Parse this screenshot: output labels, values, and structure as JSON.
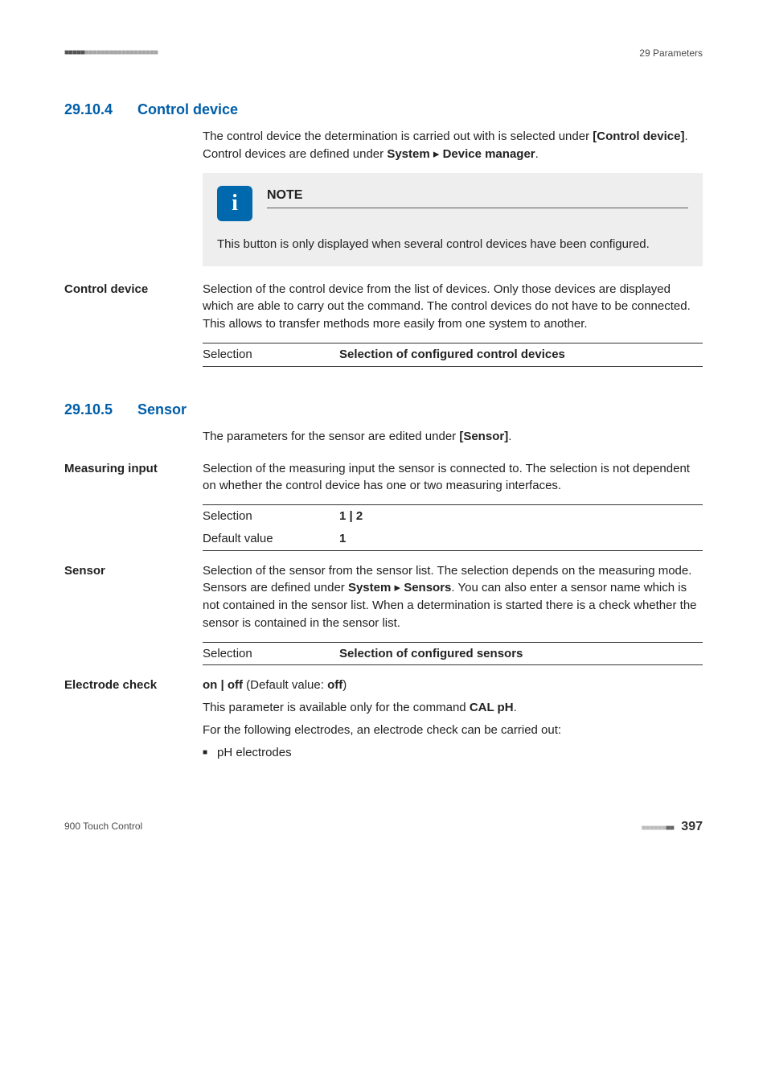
{
  "header": {
    "right": "29 Parameters"
  },
  "sections": {
    "s1": {
      "num": "29.10.4",
      "title": "Control device",
      "intro_before_bold": "The control device the determination is carried out with is selected under ",
      "intro_bold": "[Control device]",
      "intro_mid": ". Control devices are defined under ",
      "intro_path1": "System",
      "intro_path2": "Device manager",
      "intro_after": "."
    },
    "note": {
      "title": "NOTE",
      "body": "This button is only displayed when several control devices have been configured."
    },
    "control_device": {
      "label": "Control device",
      "text": "Selection of the control device from the list of devices. Only those devices are displayed which are able to carry out the command. The control devices do not have to be connected. This allows to transfer methods more easily from one system to another.",
      "sel_label": "Selection",
      "sel_value": "Selection of configured control devices"
    },
    "s2": {
      "num": "29.10.5",
      "title": "Sensor",
      "intro_before_bold": "The parameters for the sensor are edited under ",
      "intro_bold": "[Sensor]",
      "intro_after": "."
    },
    "measuring_input": {
      "label": "Measuring input",
      "text": "Selection of the measuring input the sensor is connected to. The selection is not dependent on whether the control device has one or two measuring interfaces.",
      "sel_label": "Selection",
      "sel_value": "1 | 2",
      "def_label": "Default value",
      "def_value": "1"
    },
    "sensor": {
      "label": "Sensor",
      "text_before": "Selection of the sensor from the sensor list. The selection depends on the measuring mode. Sensors are defined under ",
      "path1": "System",
      "path2": "Sensors",
      "text_after": ". You can also enter a sensor name which is not contained in the sensor list. When a determination is started there is a check whether the sensor is contained in the sensor list.",
      "sel_label": "Selection",
      "sel_value": "Selection of configured sensors"
    },
    "electrode_check": {
      "label": "Electrode check",
      "onoff_before": "on | off",
      "onoff_mid": " (Default value: ",
      "onoff_bold": "off",
      "onoff_after": ")",
      "line2_before": "This parameter is available only for the command ",
      "line2_bold": "CAL pH",
      "line2_after": ".",
      "line3": "For the following electrodes, an electrode check can be carried out:",
      "bullet1": "pH electrodes"
    }
  },
  "footer": {
    "left": "900 Touch Control",
    "page": "397"
  }
}
